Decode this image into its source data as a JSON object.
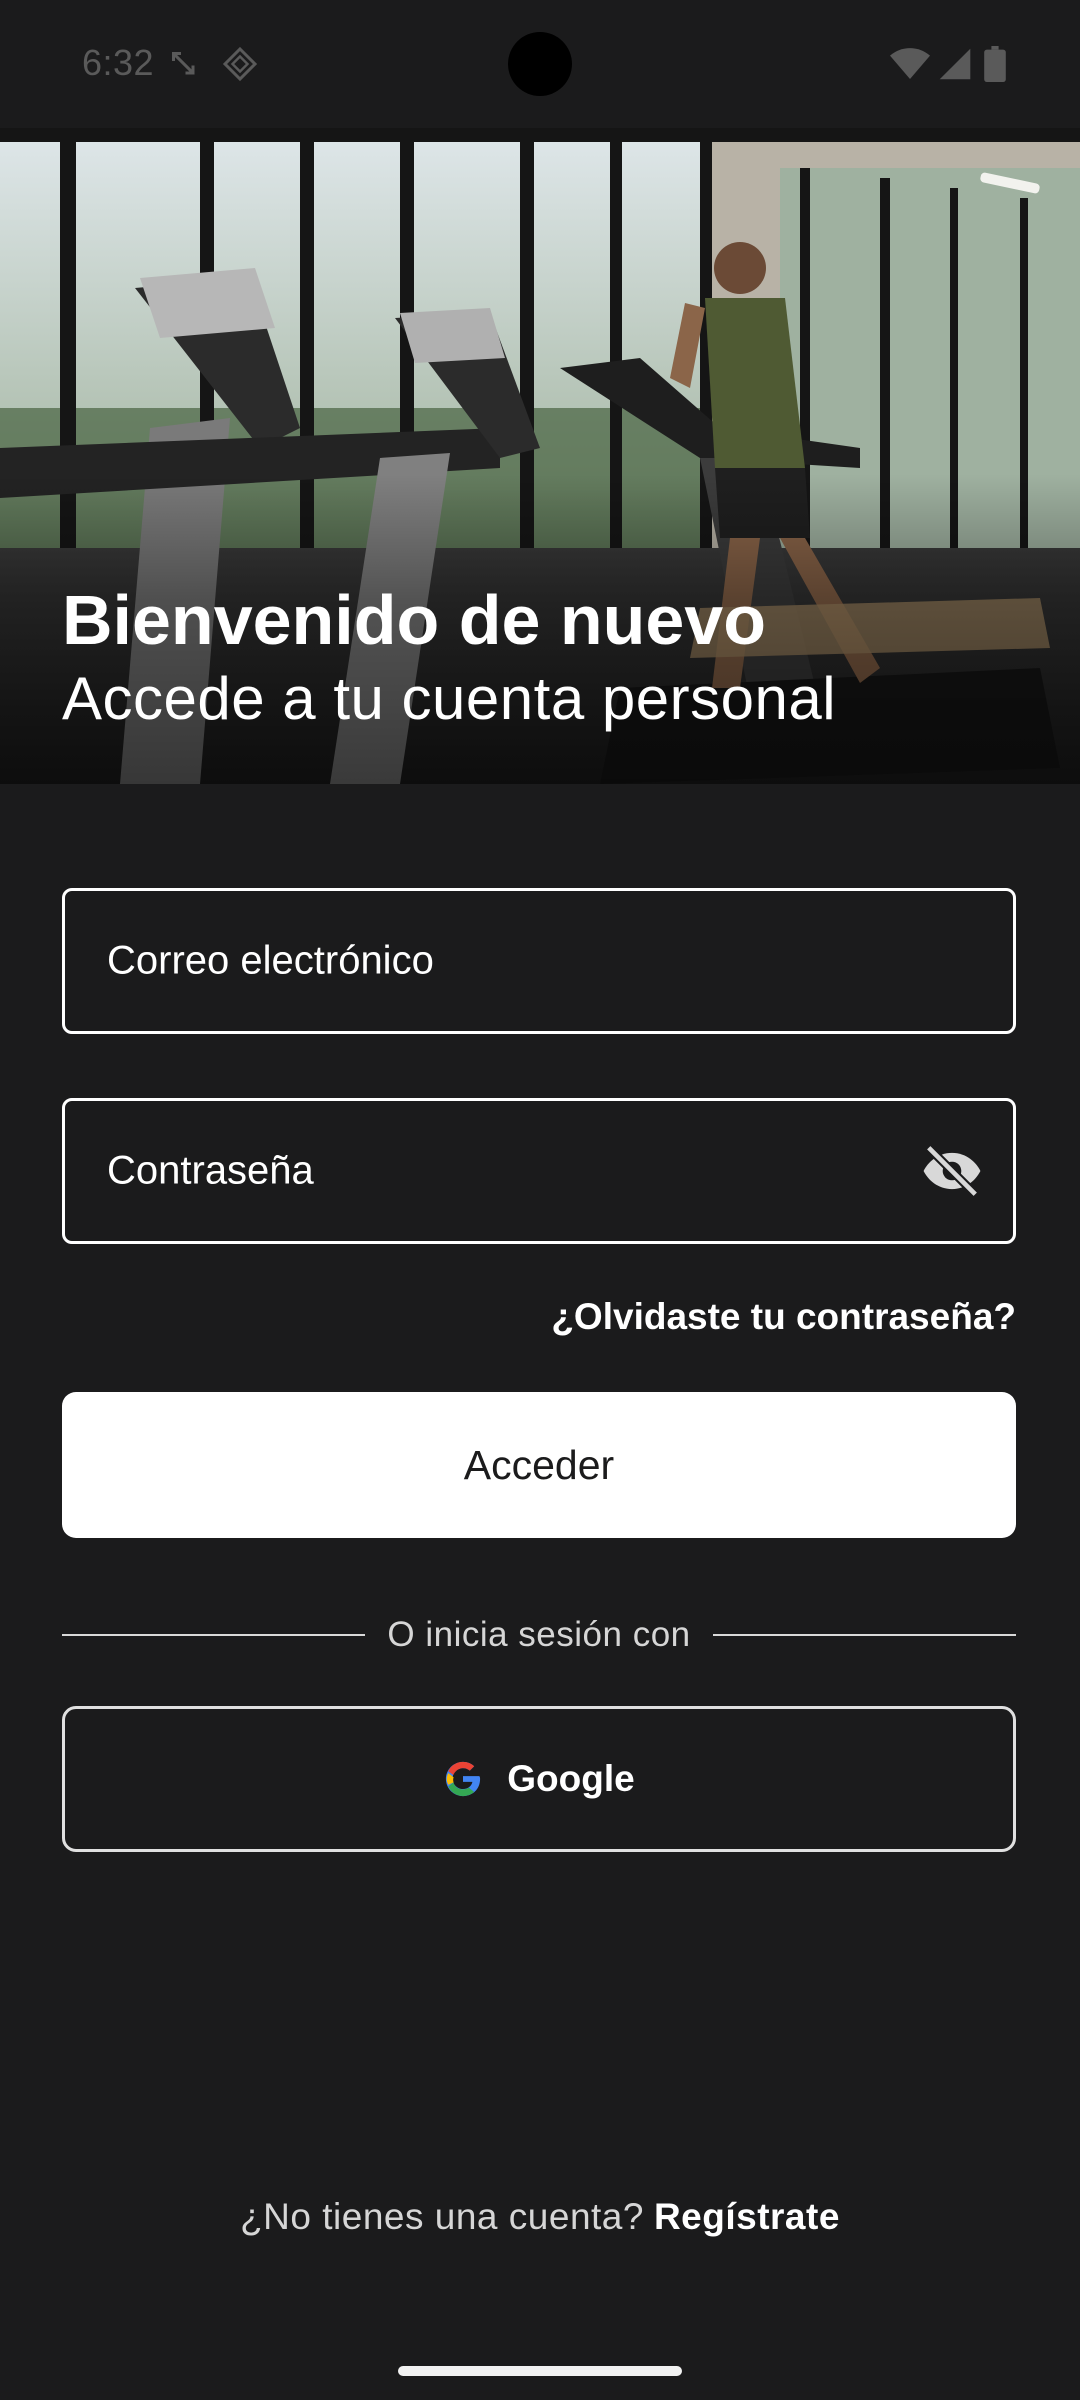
{
  "status_bar": {
    "time": "6:32",
    "left_icons": [
      "fullscreen-arrow-icon",
      "location-diamond-icon"
    ],
    "right_icons": [
      "wifi-icon",
      "signal-icon",
      "battery-icon"
    ]
  },
  "hero": {
    "image": "gym-treadmill-runner-photo",
    "title": "Bienvenido de nuevo",
    "subtitle": "Accede a tu cuenta personal"
  },
  "form": {
    "email_placeholder": "Correo electrónico",
    "password_placeholder": "Contraseña",
    "password_toggle_icon": "eye-off-icon",
    "forgot_password": "¿Olvidaste tu contraseña?",
    "submit_label": "Acceder"
  },
  "social": {
    "divider_text": "O inicia sesión con",
    "google_label": "Google",
    "google_icon": "google-logo-icon"
  },
  "signup": {
    "prompt": "¿No tienes una cuenta?",
    "link": "Regístrate"
  },
  "colors": {
    "background": "#1b1b1c",
    "primary_button": "#ffffff",
    "text": "#ffffff",
    "muted_text": "#d6d6d6"
  }
}
